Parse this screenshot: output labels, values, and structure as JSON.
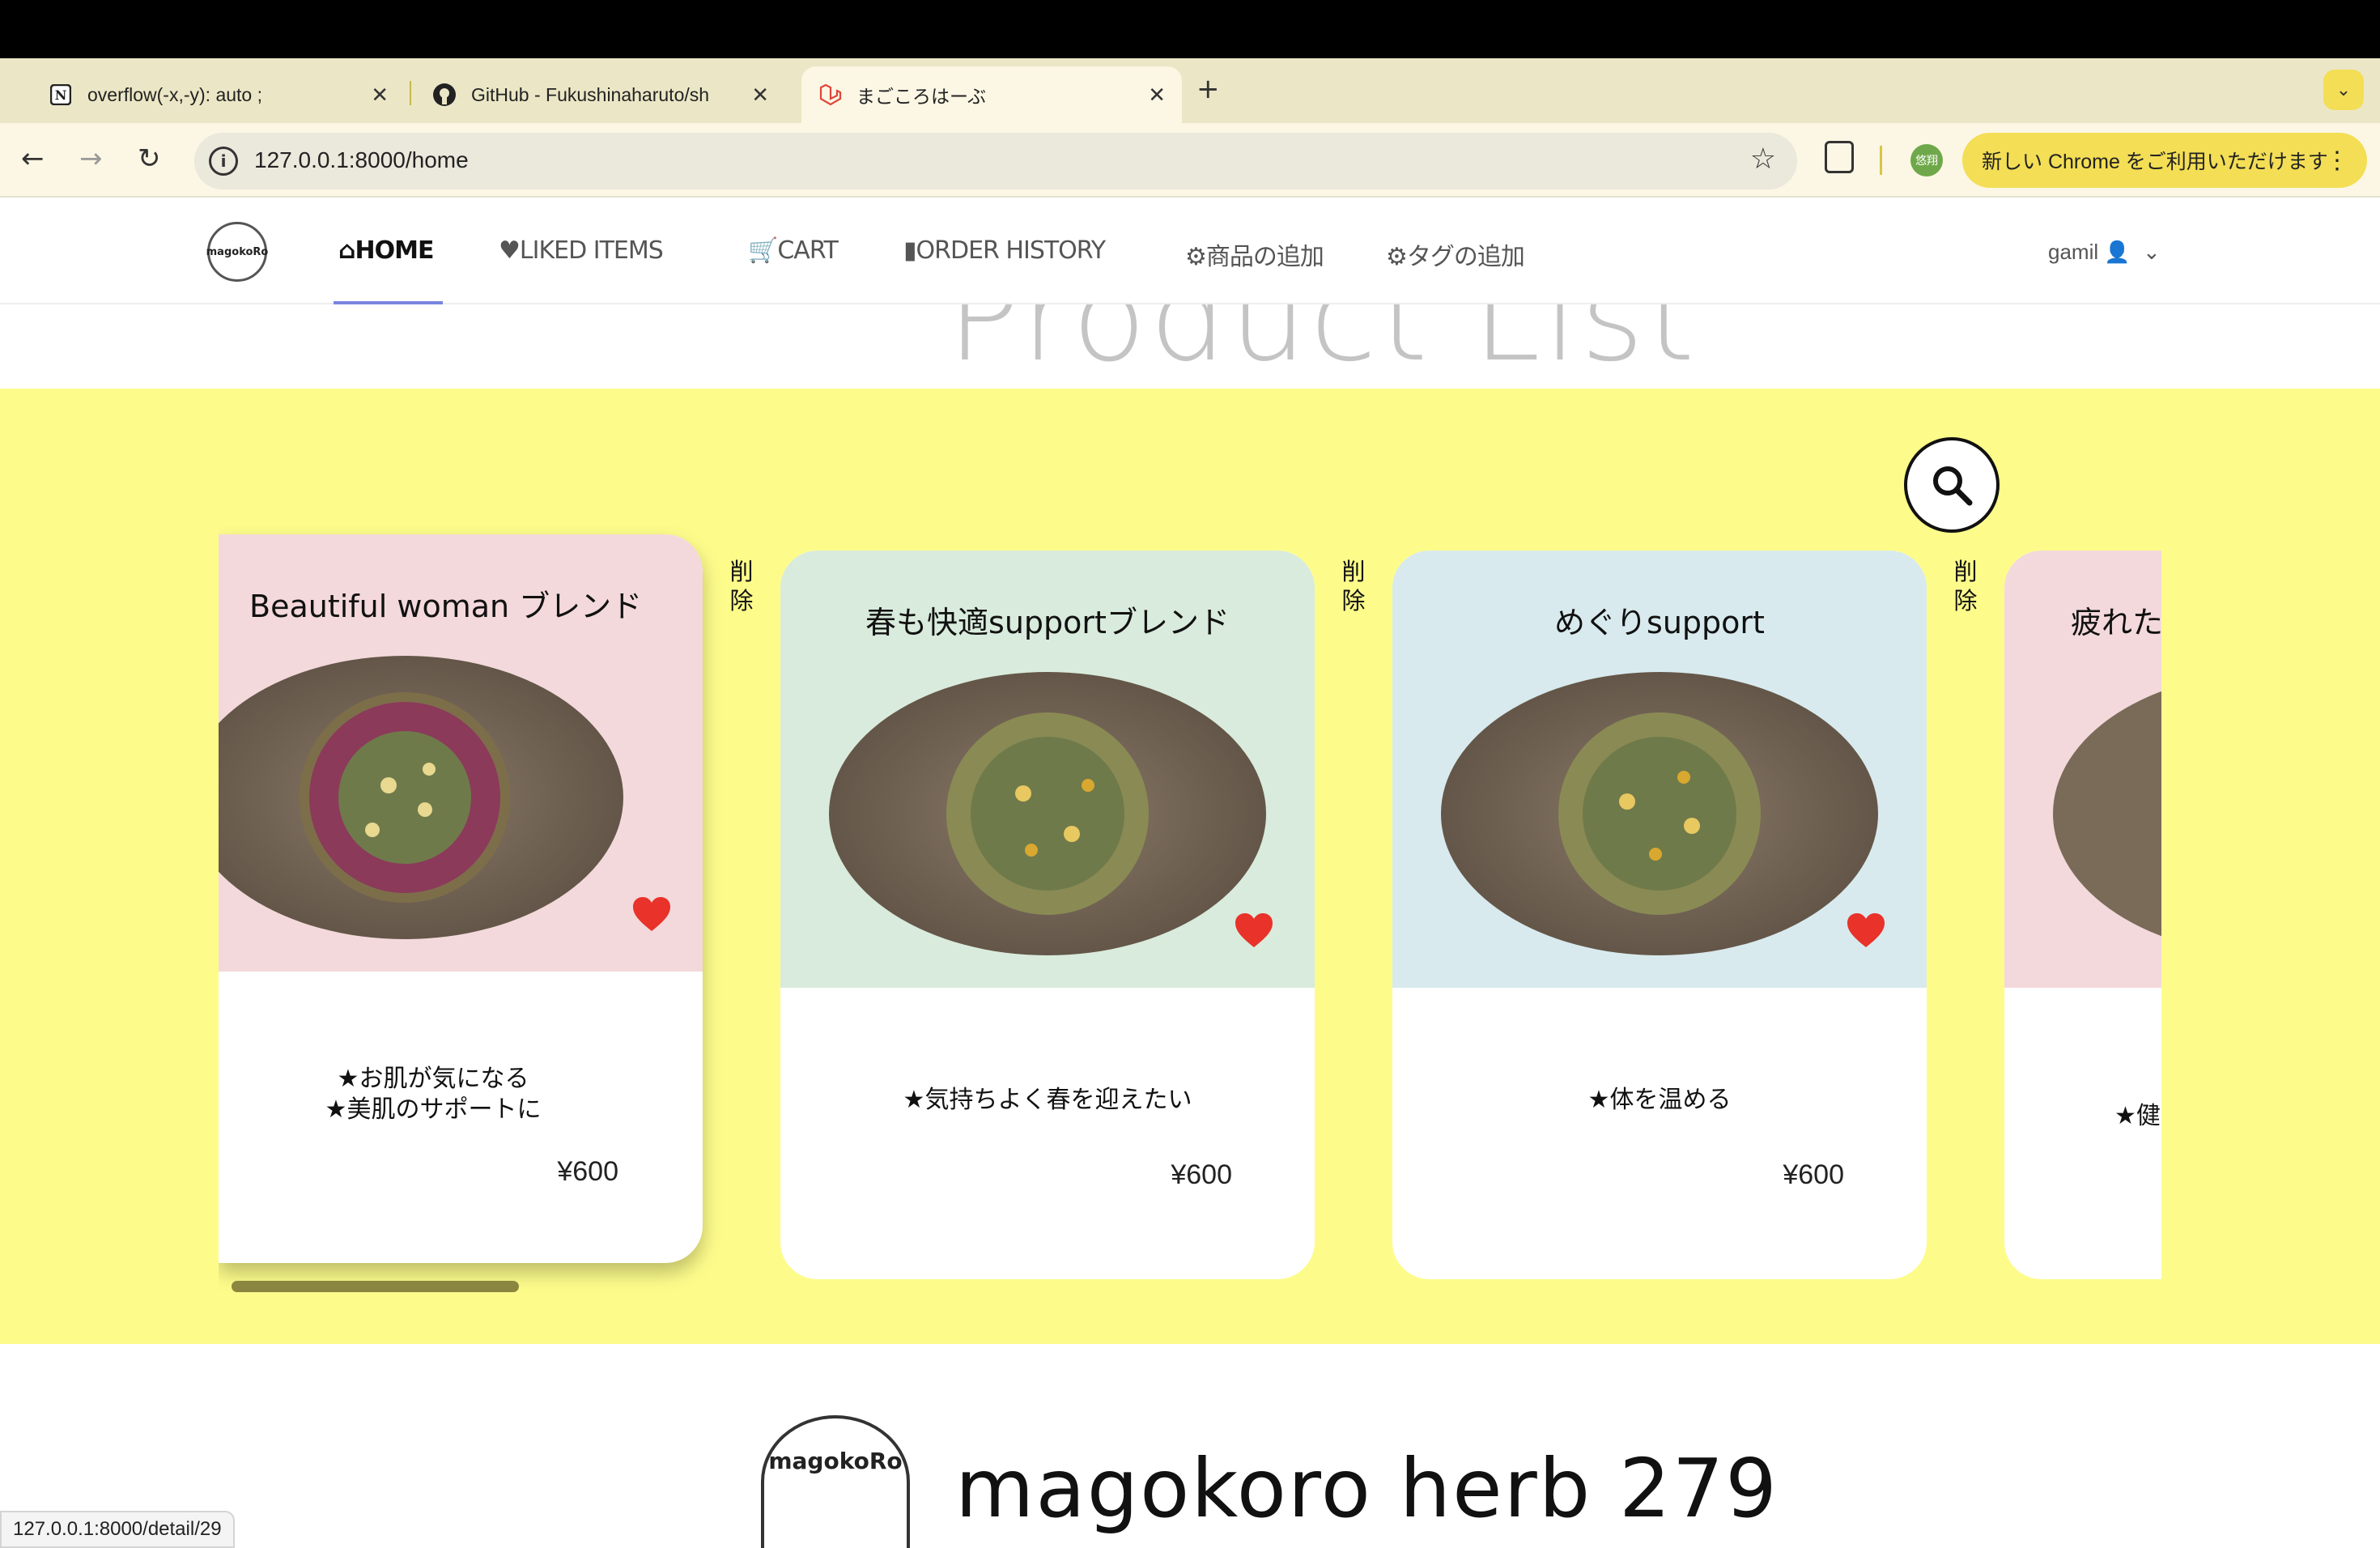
{
  "browser": {
    "tabs": [
      {
        "title": "overflow(-x,-y): auto ;",
        "icon": "notion-icon"
      },
      {
        "title": "GitHub - Fukushinaharuto/sh",
        "icon": "github-icon"
      },
      {
        "title": "まごころはーぶ",
        "icon": "laravel-icon"
      }
    ],
    "url": "127.0.0.1:8000/home",
    "profile_label": "悠翔",
    "chrome_update": "新しい Chrome をご利用いただけます",
    "status_url": "127.0.0.1:8000/detail/29"
  },
  "nav": {
    "logo_text": "magokoRo",
    "items": [
      "HOME",
      "LIKED ITEMS",
      "CART",
      "ORDER HISTORY",
      "商品の追加",
      "タグの追加"
    ],
    "user": "gamil"
  },
  "page_title": "Product List",
  "delete_label": "削除",
  "products": [
    {
      "name": "Beautiful woman ブレンド",
      "desc1": "★お肌が気になる",
      "desc2": "★美肌のサポートに",
      "price": "¥600",
      "bg": "#f3d9db",
      "liked": true
    },
    {
      "name": "春も快適supportブレンド",
      "desc1": "★気持ちよく春を迎えたい",
      "desc2": "",
      "price": "¥600",
      "bg": "#d9ebdc",
      "liked": true
    },
    {
      "name": "めぐりsupport",
      "desc1": "★体を温める",
      "desc2": "",
      "price": "¥600",
      "bg": "#d8eaee",
      "liked": true
    },
    {
      "name": "疲れた",
      "desc1": "★健",
      "desc2": "",
      "price": "",
      "bg": "#f3d9db",
      "liked": false
    }
  ],
  "footer": {
    "logo_text": "magokoRo",
    "title": "magokoro herb 279"
  },
  "colors": {
    "accent": "#7a85e0",
    "yellow_bg": "#fdfc8b",
    "heart": "#e8322a"
  }
}
